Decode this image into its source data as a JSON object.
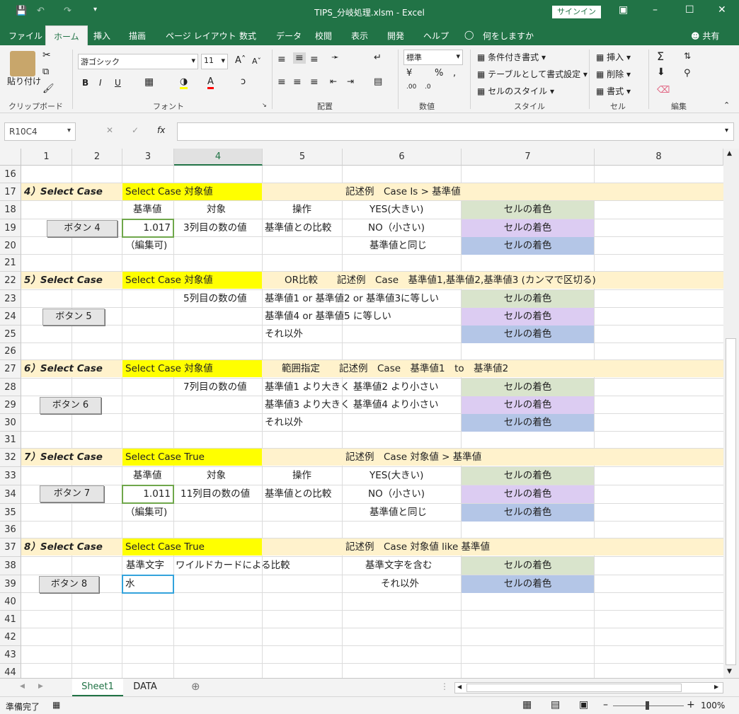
{
  "window": {
    "title": "TIPS_分岐処理.xlsm  -  Excel",
    "signin": "サインイン",
    "share": "共有"
  },
  "menu": [
    "ファイル",
    "ホーム",
    "挿入",
    "描画",
    "ページ レイアウト",
    "数式",
    "データ",
    "校閲",
    "表示",
    "開発",
    "ヘルプ",
    "何をしますか"
  ],
  "ribbon": {
    "paste": "貼り付け",
    "clipboard": "クリップボード",
    "font_name": "游ゴシック",
    "font_size": "11",
    "font": "フォント",
    "align": "配置",
    "num_format": "標準",
    "number": "数値",
    "cond": "条件付き書式",
    "table": "テーブルとして書式設定",
    "cellstyle": "セルのスタイル",
    "style": "スタイル",
    "insert": "挿入",
    "delete": "削除",
    "format": "書式",
    "cells": "セル",
    "editing": "編集"
  },
  "formula": {
    "namebox": "R10C4",
    "fx_label": "fx",
    "value": ""
  },
  "columns": [
    "1",
    "2",
    "3",
    "4",
    "5",
    "6",
    "7",
    "8"
  ],
  "rows": [
    "16",
    "17",
    "18",
    "19",
    "20",
    "21",
    "22",
    "23",
    "24",
    "25",
    "26",
    "27",
    "28",
    "29",
    "30",
    "31",
    "32",
    "33",
    "34",
    "35",
    "36",
    "37",
    "38",
    "39",
    "40",
    "41",
    "42",
    "43",
    "44"
  ],
  "content": {
    "r17a": "4）Select Case",
    "r17b": "Select Case 対象値",
    "r17c": "記述例　Case Is > 基準値",
    "r18a": "基準値",
    "r18b": "対象",
    "r18c": "操作",
    "r18d": "YES(大きい)",
    "color": "セルの着色",
    "btn4": "ボタン 4",
    "r19val": "1.017",
    "r19b": "3列目の数の値",
    "r19c": "基準値との比較",
    "r19d": "NO（小さい)",
    "edit": "（編集可)",
    "same": "基準値と同じ",
    "r22a": "5）Select Case",
    "r22b": "Select Case 対象値",
    "r22c": "OR比較　　記述例　Case　基準値1,基準値2,基準値3 (カンマで区切る)",
    "r23b": "5列目の数の値",
    "r23c": "基準値1 or 基準値2 or 基準値3に等しい",
    "btn5": "ボタン 5",
    "r24c": "基準値4 or 基準値5 に等しい",
    "other": "それ以外",
    "r27a": "6）Select Case",
    "r27b": "Select Case 対象値",
    "r27c": "範囲指定　　記述例　Case　基準値1　to　基準値2",
    "r28b": "7列目の数の値",
    "r28c": "基準値1 より大きく 基準値2 より小さい",
    "btn6": "ボタン 6",
    "r29c": "基準値3 より大きく 基準値4 より小さい",
    "r32a": "7）Select Case",
    "r32b": "Select Case True",
    "r32c": "記述例　Case 対象値 > 基準値",
    "btn7": "ボタン 7",
    "r34val": "1.011",
    "r34b": "11列目の数の値",
    "r37a": "8）Select Case",
    "r37b": "Select Case True",
    "r37c": "記述例　Case 対象値 like 基準値",
    "r38a": "基準文字",
    "r38b": "ワイルドカードによる比較",
    "r38d": "基準文字を含む",
    "btn8": "ボタン 8",
    "r39val": "水",
    "r39d": "それ以外"
  },
  "sheets": [
    "Sheet1",
    "DATA"
  ],
  "status": {
    "ready": "準備完了",
    "zoom": "100%"
  },
  "colors": {
    "brand": "#217346",
    "yellow": "#ffff00",
    "cream": "#fff2cc",
    "green": "#d9e4cc",
    "purple": "#dcccf2",
    "blue": "#b4c6e7"
  }
}
